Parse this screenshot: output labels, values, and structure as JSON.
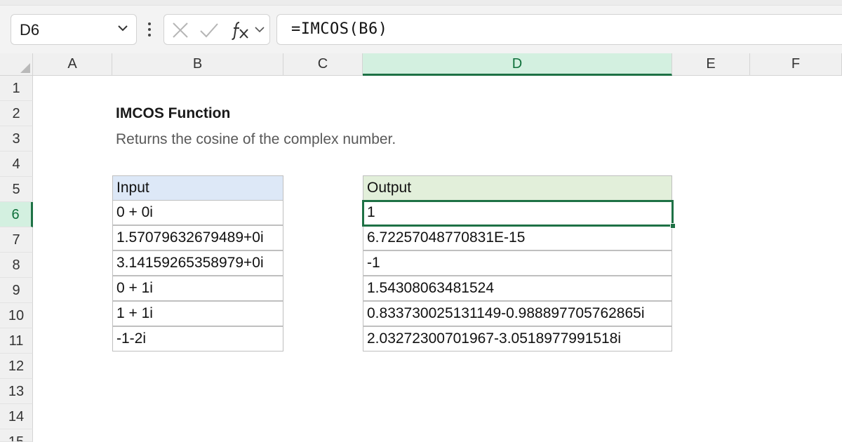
{
  "formula_bar": {
    "name_box": "D6",
    "formula": "=IMCOS(B6)",
    "icons": [
      "chevron-down-icon",
      "more-vertical-icon",
      "cancel-x-icon",
      "confirm-check-icon",
      "function-fx-icon",
      "chevron-down-icon"
    ]
  },
  "columns": [
    "A",
    "B",
    "C",
    "D",
    "E",
    "F"
  ],
  "rows": [
    "1",
    "2",
    "3",
    "4",
    "5",
    "6",
    "7",
    "8",
    "9",
    "10",
    "11",
    "12",
    "13",
    "14",
    "15"
  ],
  "selected_column": "D",
  "selected_row": "6",
  "sheet": {
    "title": "IMCOS Function",
    "subtitle": "Returns the cosine of the complex number.",
    "input_header": "Input",
    "output_header": "Output",
    "rows": [
      {
        "input": "0 + 0i",
        "output": "1"
      },
      {
        "input": "1.57079632679489+0i",
        "output": "6.72257048770831E-15"
      },
      {
        "input": "3.14159265358979+0i",
        "output": "-1"
      },
      {
        "input": "0 + 1i",
        "output": "1.54308063481524"
      },
      {
        "input": "1 + 1i",
        "output": "0.833730025131149-0.988897705762865i"
      },
      {
        "input": "-1-2i",
        "output": "2.03272300701967-3.0518977991518i"
      }
    ]
  },
  "colors": {
    "accent": "#1e7145",
    "input_header_fill": "#dde8f7",
    "output_header_fill": "#e2efda"
  }
}
